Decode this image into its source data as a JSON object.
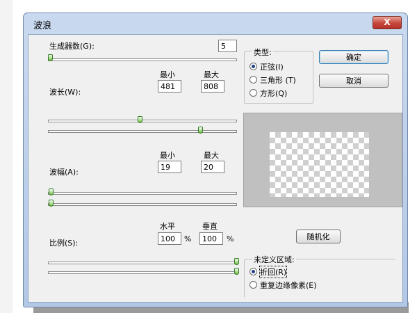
{
  "dialog": {
    "title": "波浪",
    "close_label": "X"
  },
  "generators": {
    "label": "生成器数(G):",
    "value": "5"
  },
  "wavelength": {
    "label": "波长(W):",
    "min_label": "最小",
    "max_label": "最大",
    "min": "481",
    "max": "808",
    "slider_min_level": 0.49,
    "slider_max_level": 0.81
  },
  "amplitude": {
    "label": "波幅(A):",
    "min_label": "最小",
    "max_label": "最大",
    "min": "19",
    "max": "20",
    "slider_min_level": 0.02,
    "slider_max_level": 0.02
  },
  "scale": {
    "label": "比例(S):",
    "h_label": "水平",
    "v_label": "垂直",
    "h": "100",
    "v": "100",
    "unit": "%",
    "slider_h_level": 1.0,
    "slider_v_level": 1.0
  },
  "type_group": {
    "legend": "类型:",
    "options": [
      "正弦(I)",
      "三角形 (T)",
      "方形(Q)"
    ],
    "selected": 0
  },
  "buttons": {
    "ok": "确定",
    "cancel": "取消",
    "randomize": "随机化"
  },
  "undefined_area": {
    "legend": "未定义区域:",
    "options": [
      "折回(R)",
      "重复边缘像素(E)"
    ],
    "selected": 0
  },
  "colors": {
    "title_bar": "#b3c8e6",
    "thumb": "#6fbf3f",
    "close": "#c7463a"
  }
}
